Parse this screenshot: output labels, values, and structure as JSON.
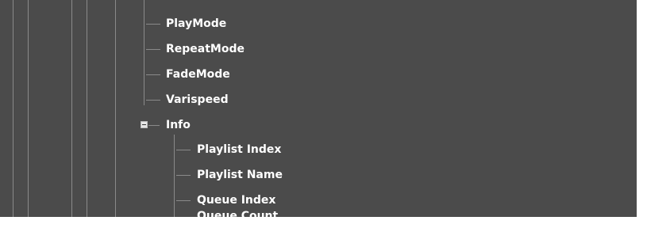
{
  "tree": {
    "children_of_parent": [
      {
        "label": "PlayMode"
      },
      {
        "label": "RepeatMode"
      },
      {
        "label": "FadeMode"
      },
      {
        "label": "Varispeed"
      }
    ],
    "info_group": {
      "label": "Info",
      "expanded": true,
      "children": [
        {
          "label": "Playlist Index"
        },
        {
          "label": "Playlist Name"
        },
        {
          "label": "Queue Index"
        },
        {
          "label": "Queue Count"
        }
      ]
    }
  },
  "colors": {
    "background": "#4b4b4b",
    "text": "#ffffff",
    "tree_line": "#8a8a8a",
    "expander": "#e6e6e6"
  }
}
